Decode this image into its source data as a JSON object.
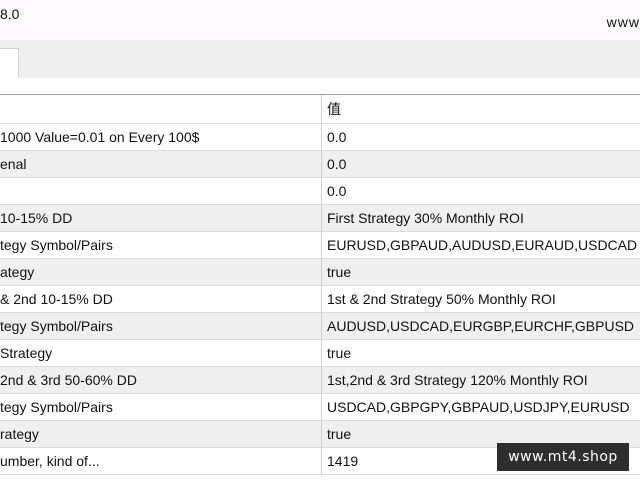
{
  "window": {
    "title_fragment": "8.0",
    "right_fragment": "www"
  },
  "grid": {
    "value_header": "值",
    "rows": [
      {
        "param": " 1000 Value=0.01 on Every 100$",
        "value": "0.0"
      },
      {
        "param": "enal",
        "value": "0.0"
      },
      {
        "param": "",
        "value": "0.0"
      },
      {
        "param": "10-15% DD",
        "value": "First Strategy 30% Monthly ROI"
      },
      {
        "param": "tegy Symbol/Pairs",
        "value": "EURUSD,GBPAUD,AUDUSD,EURAUD,USDCAD"
      },
      {
        "param": "ategy",
        "value": "true"
      },
      {
        "param": "& 2nd 10-15% DD",
        "value": "1st & 2nd Strategy 50% Monthly ROI"
      },
      {
        "param": "tegy Symbol/Pairs",
        "value": "AUDUSD,USDCAD,EURGBP,EURCHF,GBPUSD"
      },
      {
        "param": "Strategy",
        "value": "true"
      },
      {
        "param": "2nd & 3rd 50-60% DD",
        "value": "1st,2nd & 3rd Strategy 120% Monthly ROI"
      },
      {
        "param": "tegy Symbol/Pairs",
        "value": "USDCAD,GBPGPY,GBPAUD,USDJPY,EURUSD"
      },
      {
        "param": "rategy",
        "value": "true"
      },
      {
        "param": "umber, kind of...",
        "value": "1419"
      }
    ]
  },
  "watermark": "www.mt4.shop"
}
